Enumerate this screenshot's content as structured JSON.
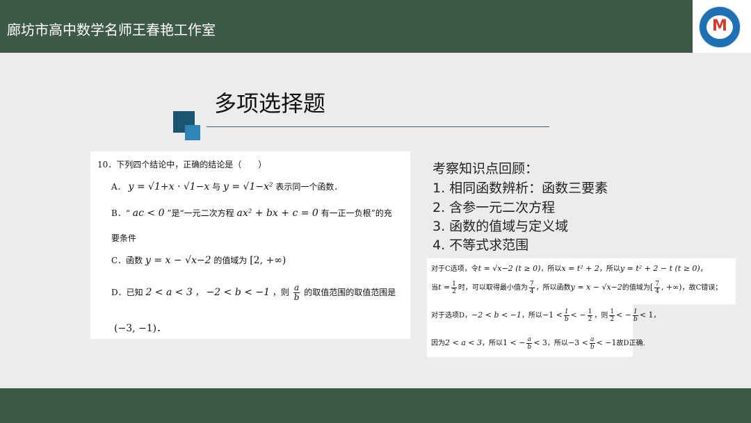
{
  "header": {
    "title": "廊坊市高中数学名师王春艳工作室",
    "logo_icon": "studio-logo-icon",
    "logo_letter": "M"
  },
  "slide": {
    "title": "多项选择题"
  },
  "question": {
    "stem": "10．下列四个结论中，正确的结论是（　　）",
    "a_label": "A．",
    "a_f1": "y = √1+x · √1−x",
    "a_join": "与",
    "a_f2": "y = √1−x²",
    "a_tail": "表示同一个函数．",
    "b_label": "B．“",
    "b_f1": "ac < 0",
    "b_mid": "”是“一元二次方程",
    "b_f2": "ax² + bx + c = 0",
    "b_tail": "有一正一负根”的充",
    "b_line2": "要条件",
    "c_label": "C．函数",
    "c_f1": "y = x − √x−2",
    "c_mid": "的值域为",
    "c_f2": "[2, +∞)",
    "d_label": "D．已知",
    "d_f1": "2 < a < 3",
    "d_comma": "，",
    "d_f2": "−2 < b < −1",
    "d_mid": "，则",
    "d_frac_num": "a",
    "d_frac_den": "b",
    "d_tail": "的取值范围的取值范围是",
    "d_line2": "(−3, −1)．"
  },
  "review": {
    "title": "考察知识点回顾：",
    "items": [
      "1. 相同函数辨析：函数三要素",
      "2. 含参一元二次方程",
      "3. 函数的值域与定义域",
      "4. 不等式求范围"
    ]
  },
  "solution_c": {
    "line1_a": "对于C选项，令",
    "line1_f1": "t = √x−2 (t ≥ 0)",
    "line1_b": "，所以",
    "line1_f2": "x = t² + 2",
    "line1_c": "，所以",
    "line1_f3": "y = t² + 2 − t (t ≥ 0)",
    "line1_d": "，",
    "line2_a": "当",
    "line2_f1a": "t =",
    "line2_frac1_num": "1",
    "line2_frac1_den": "2",
    "line2_b": "时，可以取得最小值为",
    "line2_frac2_num": "7",
    "line2_frac2_den": "4",
    "line2_c": "，所以函数",
    "line2_f2": "y = x − √x−2",
    "line2_d": "的值域为",
    "line2_f3a": "[",
    "line2_frac3_num": "7",
    "line2_frac3_den": "4",
    "line2_f3b": ", +∞)",
    "line2_e": "，故C错误；"
  },
  "solution_d": {
    "line1_a": "对于选项D，",
    "line1_f1": "−2 < b < −1",
    "line1_b": "，所以",
    "line1_f2a": "−1 <",
    "line1_frac1_num": "1",
    "line1_frac1_den": "b",
    "line1_f2b": "< −",
    "line1_frac2_num": "1",
    "line1_frac2_den": "2",
    "line1_c": "，则",
    "line1_frac3_num": "1",
    "line1_frac3_den": "2",
    "line1_f3a": "< −",
    "line1_frac4_num": "1",
    "line1_frac4_den": "b",
    "line1_f3b": "< 1",
    "line1_d": "，",
    "line2_a": "因为",
    "line2_f1": "2 < a < 3",
    "line2_b": "，所以",
    "line2_f2a": "1 < −",
    "line2_frac1_num": "a",
    "line2_frac1_den": "b",
    "line2_f2b": "< 3",
    "line2_c": "，所以",
    "line2_f3a": "−3 <",
    "line2_frac2_num": "a",
    "line2_frac2_den": "b",
    "line2_f3b": "< −1",
    "line2_d": "故D正确."
  },
  "colors": {
    "header_bg": "#3d5a48",
    "accent_dark": "#1b5470",
    "accent_light": "#2f86b6",
    "logo_red": "#d03a2f"
  }
}
